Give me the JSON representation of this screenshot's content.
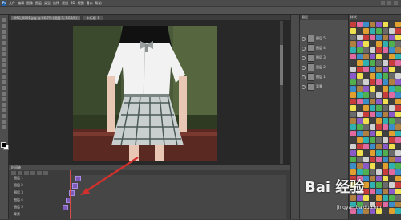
{
  "app": {
    "logo_text": "Ps",
    "menu": [
      "文件",
      "编辑",
      "图像",
      "图层",
      "类型",
      "选择",
      "滤镜",
      "3D",
      "视图",
      "窗口",
      "帮助"
    ]
  },
  "document": {
    "tabs": [
      "IMG_0001.jpg @ 66.7% (图层 1, RGB/8)",
      "未标题-1"
    ]
  },
  "timeline": {
    "title": "时间轴",
    "layers": [
      "图层 1",
      "图层 2",
      "图层 3",
      "图层 4",
      "图层 5",
      "背景"
    ]
  },
  "layers_panel": {
    "title": "图层",
    "items": [
      "图层 5",
      "图层 4",
      "图层 3",
      "图层 2",
      "图层 1",
      "背景"
    ]
  },
  "swatches": {
    "title": "样式"
  },
  "watermark": {
    "brand": "Bai 经验",
    "url": "jingyan.baidu.com"
  },
  "colors": {
    "workspace": "#282828",
    "panel": "#505050",
    "keyframe": "#7d5bb8",
    "arrow": "#d0312d"
  }
}
